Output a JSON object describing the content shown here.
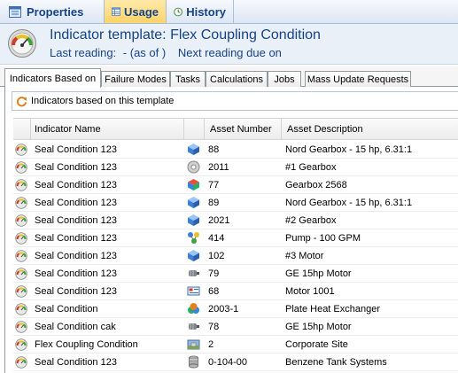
{
  "top_tabs": [
    {
      "label": "Properties",
      "icon": "properties-icon",
      "active": false
    },
    {
      "label": "Usage",
      "icon": "usage-table-icon",
      "active": true
    },
    {
      "label": "History",
      "icon": "history-clock-icon",
      "active": false
    }
  ],
  "header": {
    "title": "Indicator template: Flex Coupling Condition",
    "last_reading_label": "Last reading:",
    "last_reading_value": "- (as of )",
    "next_reading_label": "Next reading due on"
  },
  "sub_tabs": [
    {
      "label": "Indicators Based on",
      "active": true
    },
    {
      "label": "Failure Modes",
      "active": false
    },
    {
      "label": "Tasks",
      "active": false
    },
    {
      "label": "Calculations",
      "active": false
    },
    {
      "label": "Jobs",
      "active": false
    },
    {
      "label": "Mass Update Requests",
      "active": false
    }
  ],
  "ribbon": {
    "label": "Indicators based on this template",
    "icon": "refresh-icon"
  },
  "grid": {
    "columns": [
      "Indicator Name",
      "Asset Number",
      "Asset Description"
    ],
    "rows": [
      {
        "name": "Seal Condition 123",
        "asset_icon": "cube-blue-icon",
        "number": "88",
        "description": "Nord Gearbox - 15 hp, 6.31:1"
      },
      {
        "name": "Seal Condition 123",
        "asset_icon": "disc-gray-icon",
        "number": "2011",
        "description": "#1 Gearbox"
      },
      {
        "name": "Seal Condition 123",
        "asset_icon": "cube-multicolor-icon",
        "number": "77",
        "description": "Gearbox 2568"
      },
      {
        "name": "Seal Condition 123",
        "asset_icon": "cube-blue-icon",
        "number": "89",
        "description": "Nord Gearbox - 15 hp, 6.31:1"
      },
      {
        "name": "Seal Condition 123",
        "asset_icon": "cube-blue-icon",
        "number": "2021",
        "description": "#2 Gearbox"
      },
      {
        "name": "Seal Condition 123",
        "asset_icon": "molecule-icon",
        "number": "414",
        "description": "Pump - 100 GPM"
      },
      {
        "name": "Seal Condition 123",
        "asset_icon": "cube-blue-icon",
        "number": "102",
        "description": "#3 Motor"
      },
      {
        "name": "Seal Condition 123",
        "asset_icon": "motor-icon",
        "number": "79",
        "description": "GE 15hp Motor"
      },
      {
        "name": "Seal Condition 123",
        "asset_icon": "panel-icon",
        "number": "68",
        "description": "Motor 1001"
      },
      {
        "name": "Seal Condition",
        "asset_icon": "cluster-icon",
        "number": "2003-1",
        "description": "Plate Heat Exchanger"
      },
      {
        "name": "Seal Condition cak",
        "asset_icon": "motor-icon",
        "number": "78",
        "description": "GE 15hp Motor"
      },
      {
        "name": "Flex Coupling Condition",
        "asset_icon": "site-icon",
        "number": "2",
        "description": "Corporate Site"
      },
      {
        "name": "Seal Condition 123",
        "asset_icon": "tank-icon",
        "number": "0-104-00",
        "description": "Benzene Tank Systems"
      }
    ]
  },
  "colors": {
    "accent": "#15428b",
    "active_tab": "#ffd36a"
  }
}
